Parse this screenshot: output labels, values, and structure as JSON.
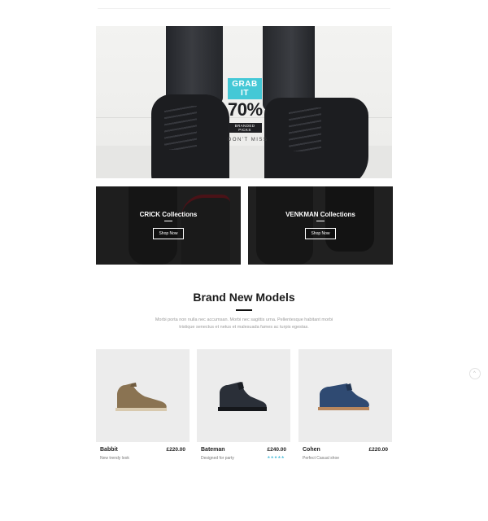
{
  "hero": {
    "promo_tag": "GRAB IT",
    "promo_percent": "70%",
    "promo_subtitle": "BRANDED PICKS",
    "promo_note": "DON'T MISS"
  },
  "collections": [
    {
      "title": "CRICK Collections",
      "button": "Shop Now"
    },
    {
      "title": "VENKMAN Collections",
      "button": "Shop Now"
    }
  ],
  "section": {
    "title": "Brand New Models",
    "description": "Morbi porta non nulla nec accumsan. Morbi nec sagittis urna. Pellentesque habitant morbi tristique senectus et netus et malesuada fames ac turpis egestas."
  },
  "products": [
    {
      "name": "Babbit",
      "price": "£220.00",
      "description": "New trendy look",
      "shoe_color": "#8a7352"
    },
    {
      "name": "Bateman",
      "price": "£240.00",
      "description": "Designed for party",
      "stars": "★★★★★",
      "shoe_color": "#2a2f38"
    },
    {
      "name": "Cohen",
      "price": "£220.00",
      "description": "Perfect Casual shoe",
      "shoe_color": "#2f4a72"
    }
  ],
  "colors": {
    "accent": "#44c8d6",
    "star": "#41b8d6"
  },
  "icons": {
    "scroll_top": "chevron-up-icon"
  }
}
